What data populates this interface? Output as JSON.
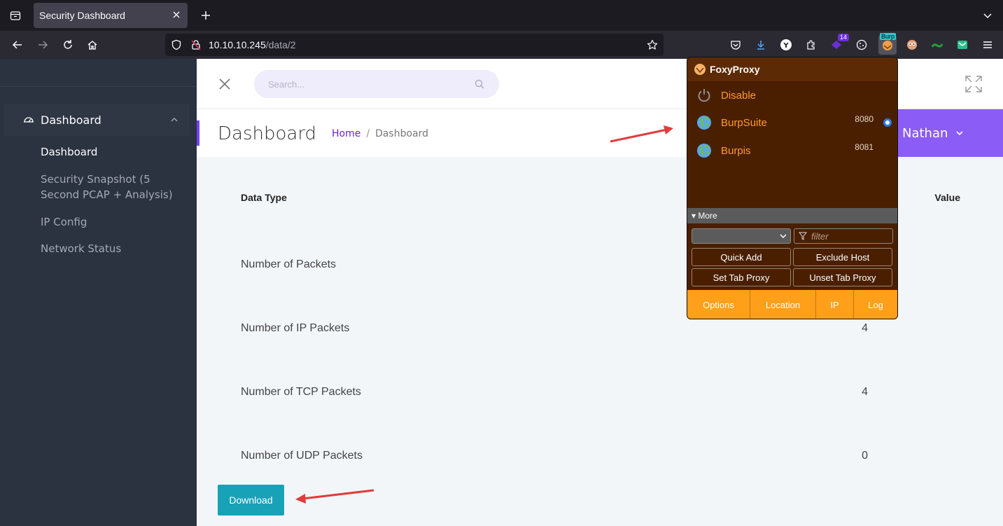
{
  "browser": {
    "tab_title": "Security Dashboard",
    "url_host": "10.10.10.245",
    "url_path": "/data/2",
    "extensions": [
      {
        "name": "pocket-icon"
      },
      {
        "name": "download-icon"
      },
      {
        "name": "y-extension-icon"
      },
      {
        "name": "puzzle-icon"
      },
      {
        "name": "proton-icon",
        "badge": "14"
      },
      {
        "name": "cookie-icon"
      },
      {
        "name": "foxyproxy-icon",
        "tag": "Burp"
      },
      {
        "name": "owl-icon"
      },
      {
        "name": "hackbar-icon"
      },
      {
        "name": "mail-icon"
      }
    ]
  },
  "sidebar": {
    "group_label": "Dashboard",
    "items": [
      {
        "label": "Dashboard",
        "active": true
      },
      {
        "label": "Security Snapshot (5 Second PCAP + Analysis)",
        "active": false
      },
      {
        "label": "IP Config",
        "active": false
      },
      {
        "label": "Network Status",
        "active": false
      }
    ]
  },
  "topbar": {
    "search_placeholder": "Search..."
  },
  "header": {
    "title": "Dashboard",
    "breadcrumb_home": "Home",
    "breadcrumb_sep": "/",
    "breadcrumb_current": "Dashboard",
    "user_name": "Nathan"
  },
  "table": {
    "col_type": "Data Type",
    "col_value": "Value",
    "rows": [
      {
        "label": "Number of Packets",
        "value": ""
      },
      {
        "label": "Number of IP Packets",
        "value": "4"
      },
      {
        "label": "Number of TCP Packets",
        "value": "4"
      },
      {
        "label": "Number of UDP Packets",
        "value": "0"
      }
    ]
  },
  "download_label": "Download",
  "foxyproxy": {
    "title": "FoxyProxy",
    "disable_label": "Disable",
    "proxies": [
      {
        "name": "BurpSuite",
        "port": "8080",
        "selected": true
      },
      {
        "name": "Burpis",
        "port": "8081",
        "selected": false
      }
    ],
    "more_label": "▾ More",
    "filter_placeholder": "filter",
    "buttons": {
      "quick_add": "Quick Add",
      "exclude_host": "Exclude Host",
      "set_tab_proxy": "Set Tab Proxy",
      "unset_tab_proxy": "Unset Tab Proxy"
    },
    "footer": {
      "options": "Options",
      "location": "Location",
      "ip": "IP",
      "log": "Log"
    }
  },
  "colors": {
    "accent": "#6f42f5",
    "download": "#17a2b8",
    "foxy_bg": "#4a1f00",
    "foxy_footer": "#ff9f1a"
  }
}
